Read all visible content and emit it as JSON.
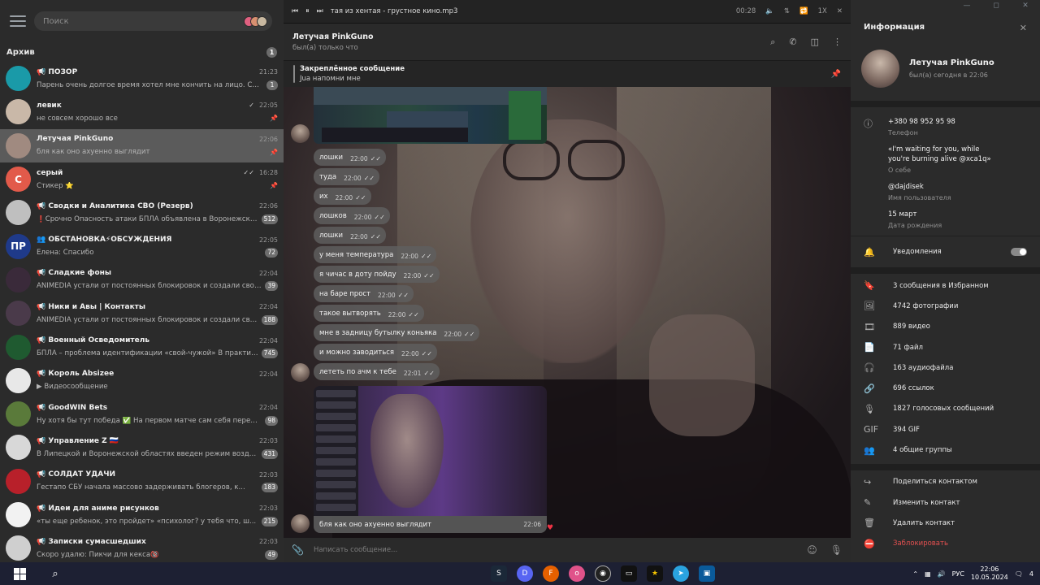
{
  "window": {
    "controls": [
      "—",
      "◻",
      "✕"
    ]
  },
  "sidebar": {
    "search_placeholder": "Поиск",
    "archive": {
      "label": "Архив",
      "count": "1"
    },
    "chats": [
      {
        "name": "📢 ПОЗОР",
        "time": "21:23",
        "msg": "Парень очень долгое время хотел мне кончить на лицо. Спустя т...",
        "badge": "1",
        "color": "#1a9aa8",
        "initial": ""
      },
      {
        "name": "левик",
        "time": "22:05",
        "msg": "не совсем хорошо все",
        "check": "✓",
        "pin": "📌",
        "color": "#c9b8a8",
        "initial": ""
      },
      {
        "name": "Летучая PinkGuno",
        "time": "22:06",
        "msg": "бля как оно ахуенно выглядит",
        "pin": "📌",
        "color": "#a08a80",
        "initial": ""
      },
      {
        "name": "серый",
        "time": "16:28",
        "msg": "Стикер ⭐",
        "check": "✓✓",
        "pin": "📌",
        "color": "#e25a4a",
        "initial": "С"
      },
      {
        "name": "📢 Сводки и Аналитика СВО (Резерв)",
        "time": "22:06",
        "msg": "❗Срочно Опасность атаки БПЛА объявлена в Воронежской и ...",
        "badge": "512",
        "color": "#bfbfbf",
        "initial": ""
      },
      {
        "name": "👥 ОБСТАНОВКА⚡ОБСУЖДЕНИЯ",
        "time": "22:05",
        "msg": "Елена: Спасибо",
        "badge": "72",
        "color": "#1f3a8a",
        "initial": "ПР"
      },
      {
        "name": "📢 Сладкие фоны",
        "time": "22:04",
        "msg": "ANIMEDIA устали от постоянных блокировок и создали свой к...",
        "badge": "39",
        "color": "#3a2a3a",
        "initial": ""
      },
      {
        "name": "📢 Ники и Авы | Контакты",
        "time": "22:04",
        "msg": "ANIMEDIA устали от постоянных блокировок и создали свой к...",
        "badge": "188",
        "color": "#4a3a4a",
        "initial": ""
      },
      {
        "name": "📢 Военный Осведомитель",
        "time": "22:04",
        "msg": "БПЛА – проблема идентификации «свой-чужой» В практике ис...",
        "badge": "745",
        "color": "#1f5a30",
        "initial": ""
      },
      {
        "name": "📢 Король Absizee",
        "time": "22:04",
        "msg": "▶ Видеосообщение",
        "color": "#e8e8e8",
        "initial": ""
      },
      {
        "name": "📢 GoodWIN Bets",
        "time": "22:04",
        "msg": "Ну хотя бы тут победа ✅ На первом матче сам себя переиг...",
        "badge": "98",
        "color": "#5a7a3a",
        "initial": ""
      },
      {
        "name": "📢 Управление Z 🇷🇺",
        "time": "22:03",
        "msg": "В Липецкой и Воронежской областях введен режим воздушной...",
        "badge": "431",
        "color": "#d8d8d8",
        "initial": ""
      },
      {
        "name": "📢 СОЛДАТ УДАЧИ",
        "time": "22:03",
        "msg": "Гестапо СБУ начала массово задерживать блогеров, к...",
        "badge": "183",
        "color": "#b8202a",
        "initial": ""
      },
      {
        "name": "📢 Идеи для аниме рисунков",
        "time": "22:03",
        "msg": "«ты еще ребенок, это пройдет» «психолог? у тебя что, ш...",
        "badge": "215",
        "color": "#f2f2f2",
        "initial": ""
      },
      {
        "name": "📢 Записки сумасшедших",
        "time": "22:03",
        "msg": "Скоро удалю: Пикчи для кекса🔞",
        "badge": "49",
        "color": "#cfcfcf",
        "initial": ""
      }
    ]
  },
  "player": {
    "title": "тая из хентая - грустное кино.mp3",
    "time": "00:28",
    "speed": "1X"
  },
  "chat": {
    "name": "Летучая PinkGuno",
    "status": "был(а) только что",
    "pinned_title": "Закреплённое сообщение",
    "pinned_text": "Jua напомни мне",
    "messages": [
      {
        "text": "лошки",
        "time": "22:00"
      },
      {
        "text": "туда",
        "time": "22:00"
      },
      {
        "text": "их",
        "time": "22:00"
      },
      {
        "text": "лошков",
        "time": "22:00"
      },
      {
        "text": "лошки",
        "time": "22:00"
      },
      {
        "text": "у меня температура",
        "time": "22:00"
      },
      {
        "text": "я чичас в доту пойду",
        "time": "22:00"
      },
      {
        "text": "на баре прост",
        "time": "22:00"
      },
      {
        "text": "такое вытворять",
        "time": "22:00"
      },
      {
        "text": "мне в задницу бутылку коньяка",
        "time": "22:00"
      },
      {
        "text": "и можно заводиться",
        "time": "22:00"
      },
      {
        "text": "лететь по ачм к тебе",
        "time": "22:01"
      }
    ],
    "caption": {
      "text": "бля как оно ахуенно выглядит",
      "time": "22:06"
    },
    "compose_placeholder": "Написать сообщение..."
  },
  "info": {
    "title": "Информация",
    "name": "Летучая PinkGuno",
    "seen": "был(а) сегодня в 22:06",
    "phone": "+380 98 952 95 98",
    "phone_label": "Телефон",
    "bio": "«I'm waiting for you, while you're burning alive @xca1q»",
    "bio_label": "О себе",
    "username": "@dajdisek",
    "username_label": "Имя пользователя",
    "birthday": "15 март",
    "birthday_label": "Дата рождения",
    "notifications": "Уведомления",
    "media": [
      "3 сообщения в Избранном",
      "4742 фотографии",
      "889 видео",
      "71 файл",
      "163 аудиофайла",
      "696 ссылок",
      "1827 голосовых сообщений",
      "394 GIF",
      "4 общие группы"
    ],
    "actions": [
      "Поделиться контактом",
      "Изменить контакт",
      "Удалить контакт",
      "Заблокировать"
    ]
  },
  "taskbar": {
    "lang": "РУС",
    "time": "22:06",
    "date": "10.05.2024",
    "notif": "4"
  }
}
